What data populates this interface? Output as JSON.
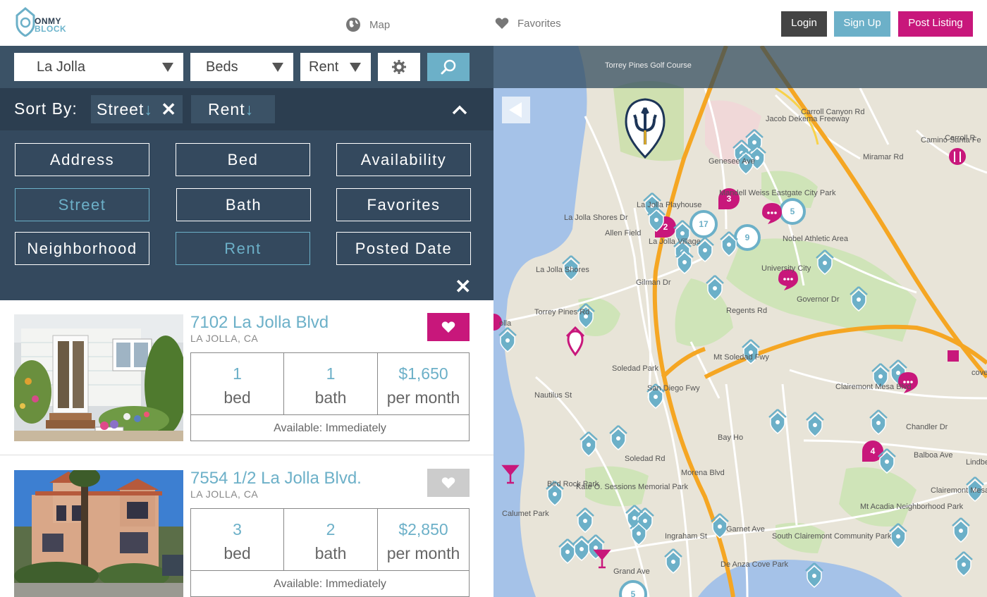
{
  "header": {
    "logo": {
      "line1": "ONMY",
      "line2": "BLOCK"
    },
    "nav": {
      "map": "Map",
      "favorites": "Favorites"
    },
    "buttons": {
      "login": "Login",
      "signup": "Sign Up",
      "post": "Post Listing"
    }
  },
  "filters": {
    "location": "La Jolla",
    "beds": "Beds",
    "rent": "Rent"
  },
  "sort": {
    "label": "Sort By:",
    "active": [
      {
        "label": "Street",
        "arrow": "↓"
      },
      {
        "label": "Rent",
        "arrow": "↓"
      }
    ],
    "options": [
      "Address",
      "Bed",
      "Availability",
      "Street",
      "Bath",
      "Favorites",
      "Neighborhood",
      "Rent",
      "Posted Date"
    ]
  },
  "listings": [
    {
      "title": "7102 La Jolla Blvd",
      "city": "LA JOLLA, CA",
      "beds": "1",
      "beds_unit": "bed",
      "baths": "1",
      "baths_unit": "bath",
      "rent": "$1,650",
      "rent_unit": "per month",
      "availability": "Available: Immediately",
      "favorited": true
    },
    {
      "title": "7554 1/2 La Jolla Blvd.",
      "city": "LA JOLLA, CA",
      "beds": "3",
      "beds_unit": "bed",
      "baths": "2",
      "baths_unit": "bath",
      "rent": "$2,850",
      "rent_unit": "per month",
      "availability": "Available: Immediately",
      "favorited": false
    }
  ],
  "map": {
    "clusters": [
      "17",
      "5",
      "9",
      "3",
      "2",
      "4",
      "5"
    ],
    "labels": {
      "torrey": "Torrey Pines Golf Course",
      "carroll_canyon": "Carroll Canyon Rd",
      "carroll": "Carroll R",
      "genesee": "Genesee Ave",
      "miramar": "Miramar Rd",
      "camino": "Camino Santa Fe",
      "jacob_dekema": "Jacob Dekema Freeway",
      "ljs_dr": "La Jolla Shores Dr",
      "allen": "Allen Field",
      "playhouse": "La Jolla Playhouse",
      "lj_village": "La Jolla Village",
      "mann": "Mandell Weiss Eastgate City Park",
      "nobel": "Nobel Athletic Area",
      "lj_shores": "La Jolla Shores",
      "torrey_rd": "Torrey Pines Rd",
      "university": "University City",
      "governor": "Governor Dr",
      "regents": "Regents Rd",
      "soledad": "Soledad Park",
      "mt_soledad": "Mt Soledad Fwy",
      "clairemont_mesa": "Clairemont Mesa Blvd",
      "chandler": "Chandler Dr",
      "nautilus": "Nautilus St",
      "bay_ho": "Bay Ho",
      "balboa": "Balboa Ave",
      "bird_rock": "Bird Rock Park",
      "sessions": "Kate O. Sessions Memorial Park",
      "calumet": "Calumet Park",
      "s_clairemont": "South Clairemont Community Park",
      "mt_acadia": "Mt Acadia Neighborhood Park",
      "clairemont_east": "Clairemont Mesa East",
      "grand": "Grand Ave",
      "de_anza": "De Anza Cove Park",
      "lindbergh": "Lindbe Fie",
      "gilman": "Gilman Dr",
      "morena": "Morena Blvd",
      "ingraham": "Ingraham St",
      "soledad_rd": "Soledad Rd",
      "sd_fwy": "San Diego Fwy",
      "garnet": "Garnet Ave",
      "jolla": "olla",
      "cove": "cove"
    }
  }
}
